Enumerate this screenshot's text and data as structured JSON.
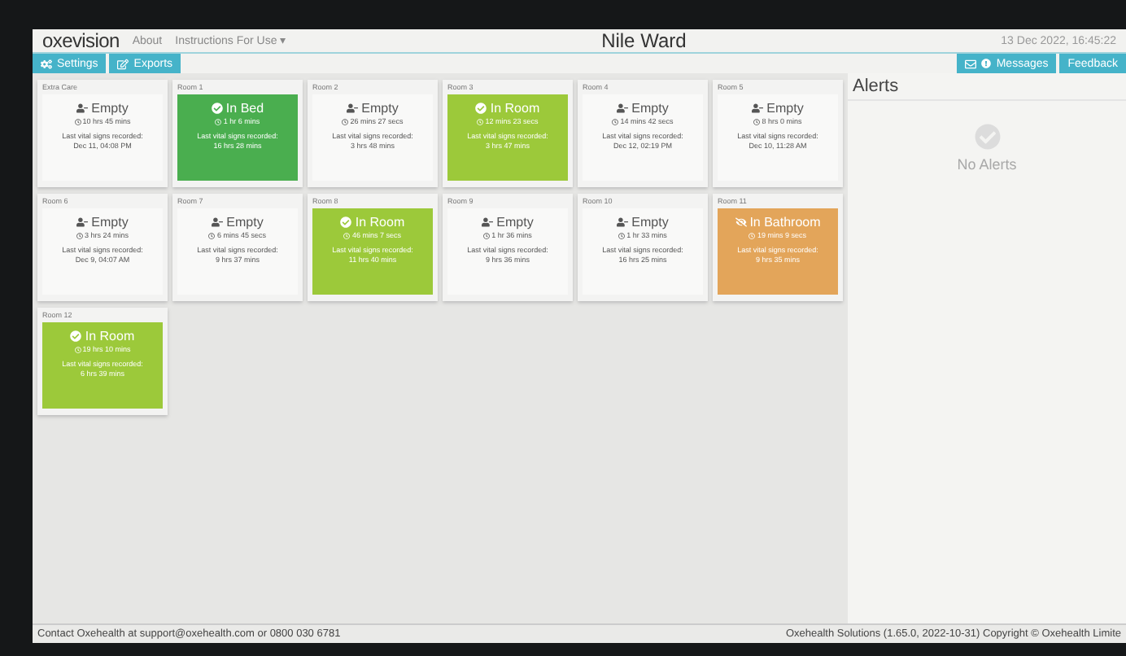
{
  "navbar": {
    "logo": "oxevision",
    "links": [
      "About",
      "Instructions For Use ▾"
    ],
    "title": "Nile Ward",
    "datetime": "13 Dec 2022, 16:45:22"
  },
  "toolbar": {
    "left": [
      {
        "label": "Settings",
        "kind": "settings"
      },
      {
        "label": "Exports",
        "kind": "export"
      }
    ],
    "right": [
      {
        "label": "Messages",
        "kind": "messages"
      },
      {
        "label": "Feedback",
        "kind": "plain"
      }
    ]
  },
  "rooms": [
    {
      "name": "Extra Care",
      "status": "Empty",
      "kind": "empty",
      "duration": "10 hrs 45 mins",
      "vitals_label": "Last vital signs recorded:",
      "vitals": "Dec 11, 04:08 PM"
    },
    {
      "name": "Room 1",
      "status": "In Bed",
      "kind": "in-bed",
      "duration": "1 hr 6 mins",
      "vitals_label": "Last vital signs recorded:",
      "vitals": "16 hrs 28 mins"
    },
    {
      "name": "Room 2",
      "status": "Empty",
      "kind": "empty",
      "duration": "26 mins 27 secs",
      "vitals_label": "Last vital signs recorded:",
      "vitals": "3 hrs 48 mins"
    },
    {
      "name": "Room 3",
      "status": "In Room",
      "kind": "in-room",
      "duration": "12 mins 23 secs",
      "vitals_label": "Last vital signs recorded:",
      "vitals": "3 hrs 47 mins"
    },
    {
      "name": "Room 4",
      "status": "Empty",
      "kind": "empty",
      "duration": "14 mins 42 secs",
      "vitals_label": "Last vital signs recorded:",
      "vitals": "Dec 12, 02:19 PM"
    },
    {
      "name": "Room 5",
      "status": "Empty",
      "kind": "empty",
      "duration": "8 hrs 0 mins",
      "vitals_label": "Last vital signs recorded:",
      "vitals": "Dec 10, 11:28 AM"
    },
    {
      "name": "Room 6",
      "status": "Empty",
      "kind": "empty",
      "duration": "3 hrs 24 mins",
      "vitals_label": "Last vital signs recorded:",
      "vitals": "Dec 9, 04:07 AM"
    },
    {
      "name": "Room 7",
      "status": "Empty",
      "kind": "empty",
      "duration": "6 mins 45 secs",
      "vitals_label": "Last vital signs recorded:",
      "vitals": "9 hrs 37 mins"
    },
    {
      "name": "Room 8",
      "status": "In Room",
      "kind": "in-room",
      "duration": "46 mins 7 secs",
      "vitals_label": "Last vital signs recorded:",
      "vitals": "11 hrs 40 mins"
    },
    {
      "name": "Room 9",
      "status": "Empty",
      "kind": "empty",
      "duration": "1 hr 36 mins",
      "vitals_label": "Last vital signs recorded:",
      "vitals": "9 hrs 36 mins"
    },
    {
      "name": "Room 10",
      "status": "Empty",
      "kind": "empty",
      "duration": "1 hr 33 mins",
      "vitals_label": "Last vital signs recorded:",
      "vitals": "16 hrs 25 mins"
    },
    {
      "name": "Room 11",
      "status": "In Bathroom",
      "kind": "in-bathroom",
      "duration": "19 mins 9 secs",
      "vitals_label": "Last vital signs recorded:",
      "vitals": "9 hrs 35 mins"
    },
    {
      "name": "Room 12",
      "status": "In Room",
      "kind": "in-room",
      "duration": "19 hrs 10 mins",
      "vitals_label": "Last vital signs recorded:",
      "vitals": "6 hrs 39 mins"
    }
  ],
  "alerts": {
    "title": "Alerts",
    "empty_text": "No Alerts"
  },
  "footer": {
    "contact": "Contact Oxehealth at support@oxehealth.com or 0800 030 6781",
    "version": "Oxehealth Solutions (1.65.0, 2022-10-31) Copyright © Oxehealth Limite"
  }
}
